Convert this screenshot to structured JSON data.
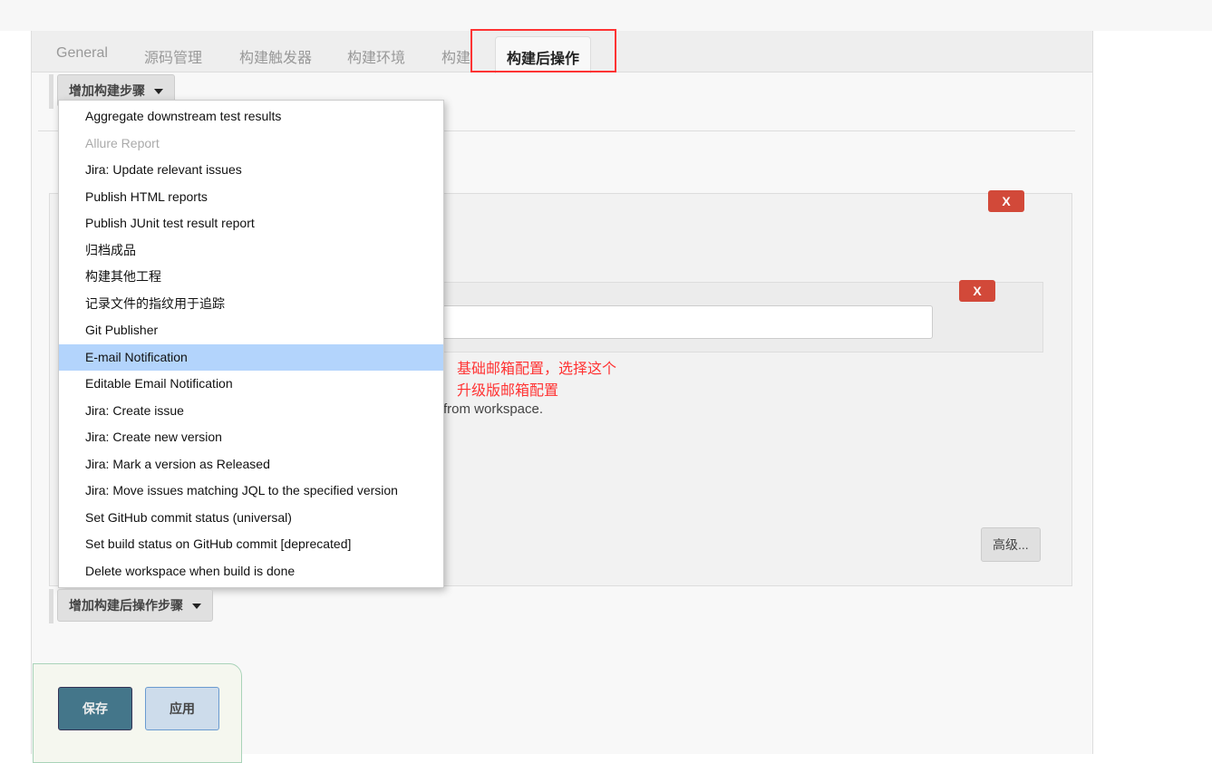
{
  "tabs": [
    "General",
    "源码管理",
    "构建触发器",
    "构建环境",
    "构建",
    "构建后操作"
  ],
  "add_build_step": "增加构建步骤",
  "add_post_build_step": "增加构建后操作步骤",
  "menu_items": [
    "Aggregate downstream test results",
    "Allure Report",
    "Jira: Update relevant issues",
    "Publish HTML reports",
    "Publish JUnit test result report",
    "归档成品",
    "构建其他工程",
    "记录文件的指纹用于追踪",
    "Git Publisher",
    "E-mail Notification",
    "Editable Email Notification",
    "Jira: Create issue",
    "Jira: Create new version",
    "Jira: Mark a version as Released",
    "Jira: Move issues matching JQL to the specified version",
    "Set GitHub commit status (universal)",
    "Set build status on GitHub commit [deprecated]",
    "Delete workspace when build is done"
  ],
  "delete_label": "X",
  "annotation": [
    "基础邮箱配置，选择这个",
    "升级版邮箱配置"
  ],
  "workspace_text": "from workspace.",
  "advanced_label": "高级...",
  "save_label": "保存",
  "apply_label": "应用"
}
